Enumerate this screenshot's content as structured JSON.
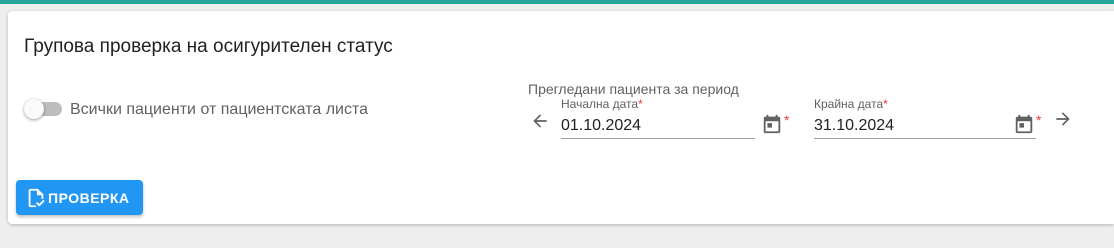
{
  "page": {
    "title": "Групова проверка на осигурителен статус"
  },
  "toggle": {
    "label": "Всички пациенти от пациентската листа",
    "checked": false
  },
  "period": {
    "label": "Прегледани пациента за период",
    "start": {
      "label": "Начална дата",
      "required_mark": "*",
      "value": "01.10.2024"
    },
    "end": {
      "label": "Крайна дата",
      "required_mark": "*",
      "value": "31.10.2024"
    },
    "prev_icon": "arrow-left-icon",
    "next_icon": "arrow-right-icon",
    "calendar_icon": "calendar-icon"
  },
  "actions": {
    "check_label": "ПРОВЕРКА",
    "check_icon": "file-check-icon"
  },
  "colors": {
    "accent_top": "#26a69a",
    "primary": "#2196f3",
    "required": "#e53935"
  }
}
